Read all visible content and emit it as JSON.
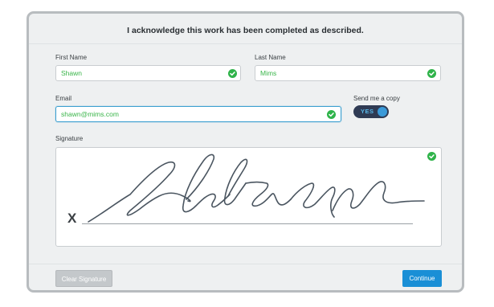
{
  "form": {
    "title": "I acknowledge this work has been completed as described.",
    "first_name": {
      "label": "First Name",
      "value": "Shawn"
    },
    "last_name": {
      "label": "Last Name",
      "value": "Mims"
    },
    "email": {
      "label": "Email",
      "value": "shawn@mims.com"
    },
    "send_copy": {
      "label": "Send me a copy",
      "toggle_text": "YES",
      "on": true
    },
    "signature": {
      "label": "Signature",
      "x_mark": "X"
    }
  },
  "buttons": {
    "clear_label": "Clear Signature",
    "continue_label": "Continue"
  },
  "colors": {
    "valid_green": "#2fb34a",
    "value_green": "#3ab54a",
    "accent_blue": "#1a8fd6",
    "toggle_bg": "#2f3b54",
    "focus_border": "#3c9fd0"
  },
  "icons": {
    "valid": "check-circle-icon"
  }
}
